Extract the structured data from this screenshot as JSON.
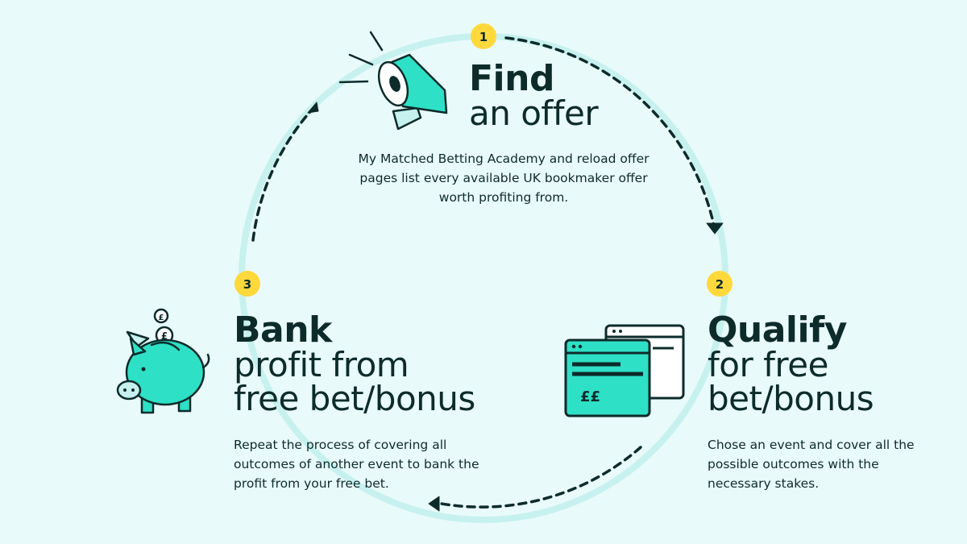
{
  "colors": {
    "background": "#e9fafa",
    "ring": "#c6f1ee",
    "accent": "#2ee0c6",
    "badge": "#ffd93b",
    "ink": "#0d2b2b"
  },
  "steps": [
    {
      "number": "1",
      "heading": "Find",
      "subheading": "an offer",
      "description": "My Matched Betting Academy and reload offer pages list every available UK bookmaker offer worth profiting from.",
      "icon": "megaphone-icon"
    },
    {
      "number": "2",
      "heading": "Qualify",
      "subheading_line1": "for free",
      "subheading_line2": "bet/bonus",
      "description": "Chose an event and cover all the possible outcomes with the necessary stakes.",
      "icon": "browser-windows-icon",
      "icon_text": "££"
    },
    {
      "number": "3",
      "heading": "Bank",
      "subheading_line1": "profit from",
      "subheading_line2": "free bet/bonus",
      "description": "Repeat the process of covering all outcomes of another event to bank the profit from your free bet.",
      "icon": "piggy-bank-icon",
      "icon_text": "£"
    }
  ]
}
